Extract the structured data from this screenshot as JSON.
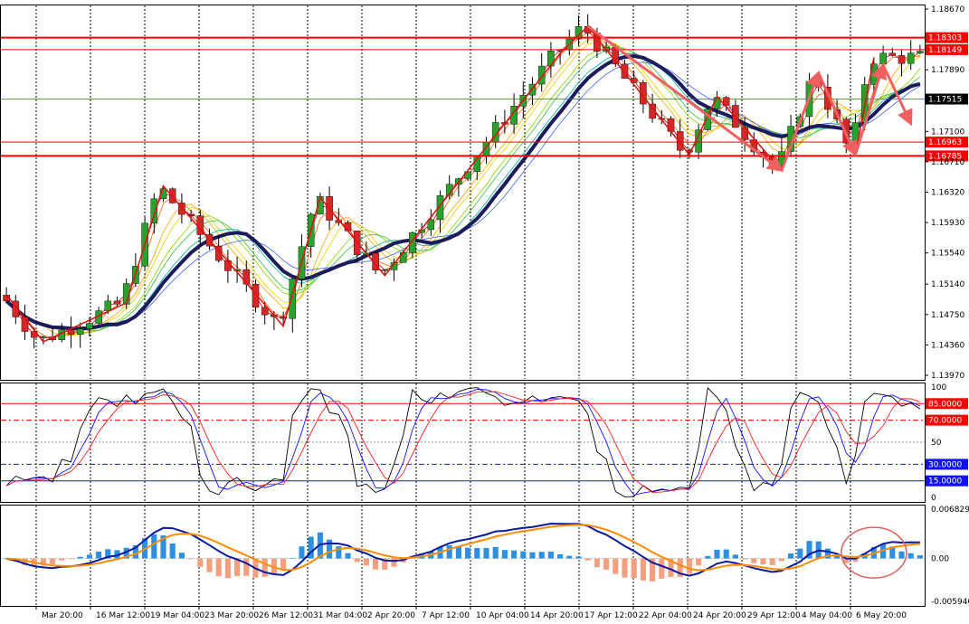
{
  "colors": {
    "background": "#ffffff",
    "grid": "#000000",
    "bull": "#2ca02c",
    "bear": "#d62728",
    "wick": "#000000",
    "trend_ma": "#1c1c5c",
    "zigzag": "#e01010",
    "arrow": "#f06060",
    "level": "#ff0000",
    "current": "#3060d0",
    "histo_pos": "#2e8fe0",
    "histo_neg": "#f4a080",
    "macd_line": "#0a1aa0",
    "signal_line": "#ff8c00",
    "stoch_k": "#000000",
    "stoch_d": "#1010ff",
    "stoch_slow": "#ff2020",
    "circle": "#e06060"
  },
  "chart_data": [
    {
      "type": "candlestick",
      "panel": "price",
      "grid": true,
      "y_ticks": [
        "1.18670",
        "1.17890",
        "1.17100",
        "1.16710",
        "1.16320",
        "1.15930",
        "1.15540",
        "1.15140",
        "1.14750",
        "1.14360",
        "1.13970"
      ],
      "ylim": [
        1.1397,
        1.1867
      ],
      "levels": [
        {
          "label": "1.18303",
          "value": 1.18303,
          "color": "#ff0000"
        },
        {
          "label": "1.18149",
          "value": 1.18149,
          "color": "#ff0000"
        },
        {
          "label": "1.16963",
          "value": 1.16963,
          "color": "#ff0000"
        },
        {
          "label": "1.16785",
          "value": 1.16785,
          "color": "#ff0000"
        }
      ],
      "current_price": {
        "label": "1.17515",
        "value": 1.17515
      },
      "zigzag": [
        [
          0,
          1.15
        ],
        [
          4,
          1.144
        ],
        [
          13,
          1.149
        ],
        [
          17,
          1.164
        ],
        [
          30,
          1.146
        ],
        [
          34,
          1.1625
        ],
        [
          41,
          1.1525
        ],
        [
          52,
          1.169
        ],
        [
          60,
          1.181
        ],
        [
          63,
          1.1845
        ],
        [
          74,
          1.168
        ],
        [
          77,
          1.1755
        ],
        [
          84,
          1.166
        ],
        [
          88,
          1.1785
        ],
        [
          92,
          1.168
        ],
        [
          94,
          1.1805
        ]
      ],
      "arrows": [
        [
          [
            63,
            1.1845
          ],
          [
            84,
            1.166
          ]
        ],
        [
          [
            84,
            1.166
          ],
          [
            88,
            1.1785
          ]
        ],
        [
          [
            88,
            1.1785
          ],
          [
            92,
            1.168
          ]
        ],
        [
          [
            92,
            1.168
          ],
          [
            95,
            1.1795
          ]
        ],
        [
          [
            95,
            1.1795
          ],
          [
            98,
            1.172
          ]
        ]
      ]
    },
    {
      "type": "line",
      "panel": "stochastic",
      "y_ticks": [
        "100",
        "85.0000",
        "70.0000",
        "50",
        "30.0000",
        "15.0000",
        "0"
      ],
      "ylim": [
        0,
        100
      ],
      "levels": [
        85,
        70,
        50,
        30,
        15
      ],
      "tag_levels": [
        {
          "label": "85.0000",
          "value": 85,
          "color": "#ff0000"
        },
        {
          "label": "70.0000",
          "value": 70,
          "color": "#ff0000"
        },
        {
          "label": "30.0000",
          "value": 30,
          "color": "#1010ff"
        },
        {
          "label": "15.0000",
          "value": 15,
          "color": "#1010ff"
        }
      ]
    },
    {
      "type": "bar",
      "panel": "macd",
      "y_ticks": [
        "0.006829",
        "0.00",
        "-0.005940"
      ],
      "ylim": [
        -0.00594,
        0.006829
      ]
    }
  ],
  "x_ticks": [
    "Mar 20:00",
    "16 Mar 12:00",
    "19 Mar 04:00",
    "23 Mar 20:00",
    "26 Mar 12:00",
    "31 Mar 04:00",
    "2 Apr 20:00",
    "7 Apr 12:00",
    "10 Apr 04:00",
    "14 Apr 20:00",
    "17 Apr 12:00",
    "22 Apr 04:00",
    "24 Apr 20:00",
    "29 Apr 12:00",
    "4 May 04:00",
    "6 May 20:00"
  ],
  "x_positions": [
    0,
    1,
    2,
    3,
    4,
    5,
    6,
    7,
    8,
    9,
    10,
    11,
    12,
    13,
    14,
    15
  ]
}
